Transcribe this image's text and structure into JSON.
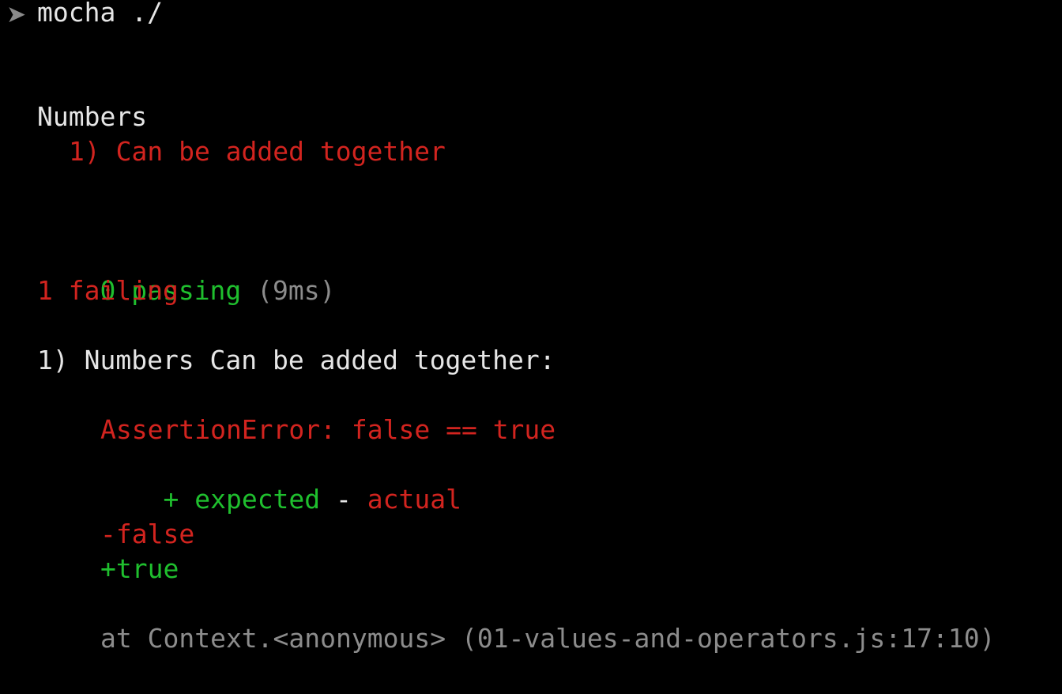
{
  "terminal": {
    "prompt_symbol": "➤",
    "command": "mocha ./",
    "suite_name": "Numbers",
    "test_fail_line": "1) Can be added together",
    "summary": {
      "passing_count": "0 passing",
      "passing_time": "(9ms)",
      "failing_count": "1 failing"
    },
    "failure": {
      "title": "1) Numbers Can be added together:",
      "error": "AssertionError: false == true",
      "diff_legend_plus": "+ expected",
      "diff_legend_sep": " - ",
      "diff_legend_minus": "actual",
      "diff_minus": "-false",
      "diff_plus": "+true",
      "stack": "at Context.<anonymous> (01-values-and-operators.js:17:10)"
    }
  },
  "colors": {
    "background": "#000000",
    "text": "#e6e6e6",
    "red": "#d2241f",
    "green": "#1fbf2e",
    "gray": "#8c8c8c"
  }
}
